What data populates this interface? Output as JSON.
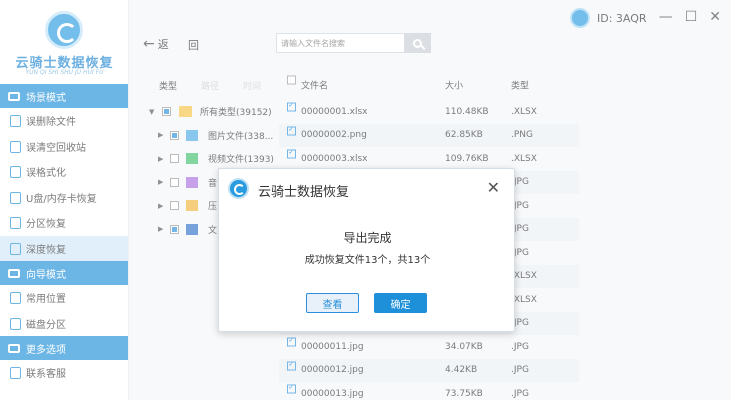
{
  "app": {
    "title": "云骑士数据恢复",
    "subtitle": "YUN QI SHI SHU JU HUI FU",
    "user_id": "ID: 3AQR",
    "accent": "#1e8fd9"
  },
  "sidebar": {
    "sections": [
      {
        "label": "场景模式",
        "items": [
          {
            "label": "误删除文件",
            "active": false
          },
          {
            "label": "误清空回收站",
            "active": false
          },
          {
            "label": "误格式化",
            "active": false
          },
          {
            "label": "U盘/内存卡恢复",
            "active": false
          },
          {
            "label": "分区恢复",
            "active": false
          },
          {
            "label": "深度恢复",
            "active": true
          }
        ]
      },
      {
        "label": "向导模式",
        "items": [
          {
            "label": "常用位置",
            "active": false
          },
          {
            "label": "磁盘分区",
            "active": false
          }
        ]
      },
      {
        "label": "更多选项",
        "items": [
          {
            "label": "联系客服",
            "active": false
          }
        ]
      }
    ]
  },
  "topbar": {
    "back_label": "返",
    "forward_label": "回",
    "search_placeholder": "请输入文件名搜索",
    "window_controls": [
      "—",
      "☐",
      "✕"
    ]
  },
  "tree": {
    "tabs": [
      {
        "label": "类型",
        "dim": false
      },
      {
        "label": "路径",
        "dim": true
      },
      {
        "label": "时间",
        "dim": true
      }
    ],
    "rows": [
      {
        "label": "所有类型(39152)",
        "level": 0
      },
      {
        "label": "图片文件(338...",
        "level": 1
      },
      {
        "label": "视频文件(1393)",
        "level": 1
      },
      {
        "label": "音",
        "level": 1
      },
      {
        "label": "压",
        "level": 1
      },
      {
        "label": "文",
        "level": 1
      }
    ]
  },
  "files": {
    "headers": {
      "name": "文件名",
      "size": "大小",
      "type": "类型"
    },
    "rows": [
      {
        "name": "00000001.xlsx",
        "size": "110.48KB",
        "type": ".XLSX"
      },
      {
        "name": "00000002.png",
        "size": "62.85KB",
        "type": ".PNG"
      },
      {
        "name": "00000003.xlsx",
        "size": "109.76KB",
        "type": ".XLSX"
      },
      {
        "name": "",
        "size": "",
        "type": ".JPG"
      },
      {
        "name": "",
        "size": "",
        "type": ".JPG"
      },
      {
        "name": "",
        "size": "",
        "type": ".JPG"
      },
      {
        "name": "",
        "size": "",
        "type": ".JPG"
      },
      {
        "name": "",
        "size": "",
        "type": ".XLSX"
      },
      {
        "name": "",
        "size": "",
        "type": ".XLSX"
      },
      {
        "name": "",
        "size": "",
        "type": ".JPG"
      },
      {
        "name": "00000011.jpg",
        "size": "34.07KB",
        "type": ".JPG"
      },
      {
        "name": "00000012.jpg",
        "size": "4.42KB",
        "type": ".JPG"
      },
      {
        "name": "00000013.jpg",
        "size": "73.75KB",
        "type": ".JPG"
      }
    ]
  },
  "modal": {
    "title": "云骑士数据恢复",
    "close": "✕",
    "heading": "导出完成",
    "message": "成功恢复文件13个，共13个",
    "view_label": "查看",
    "ok_label": "确定"
  }
}
